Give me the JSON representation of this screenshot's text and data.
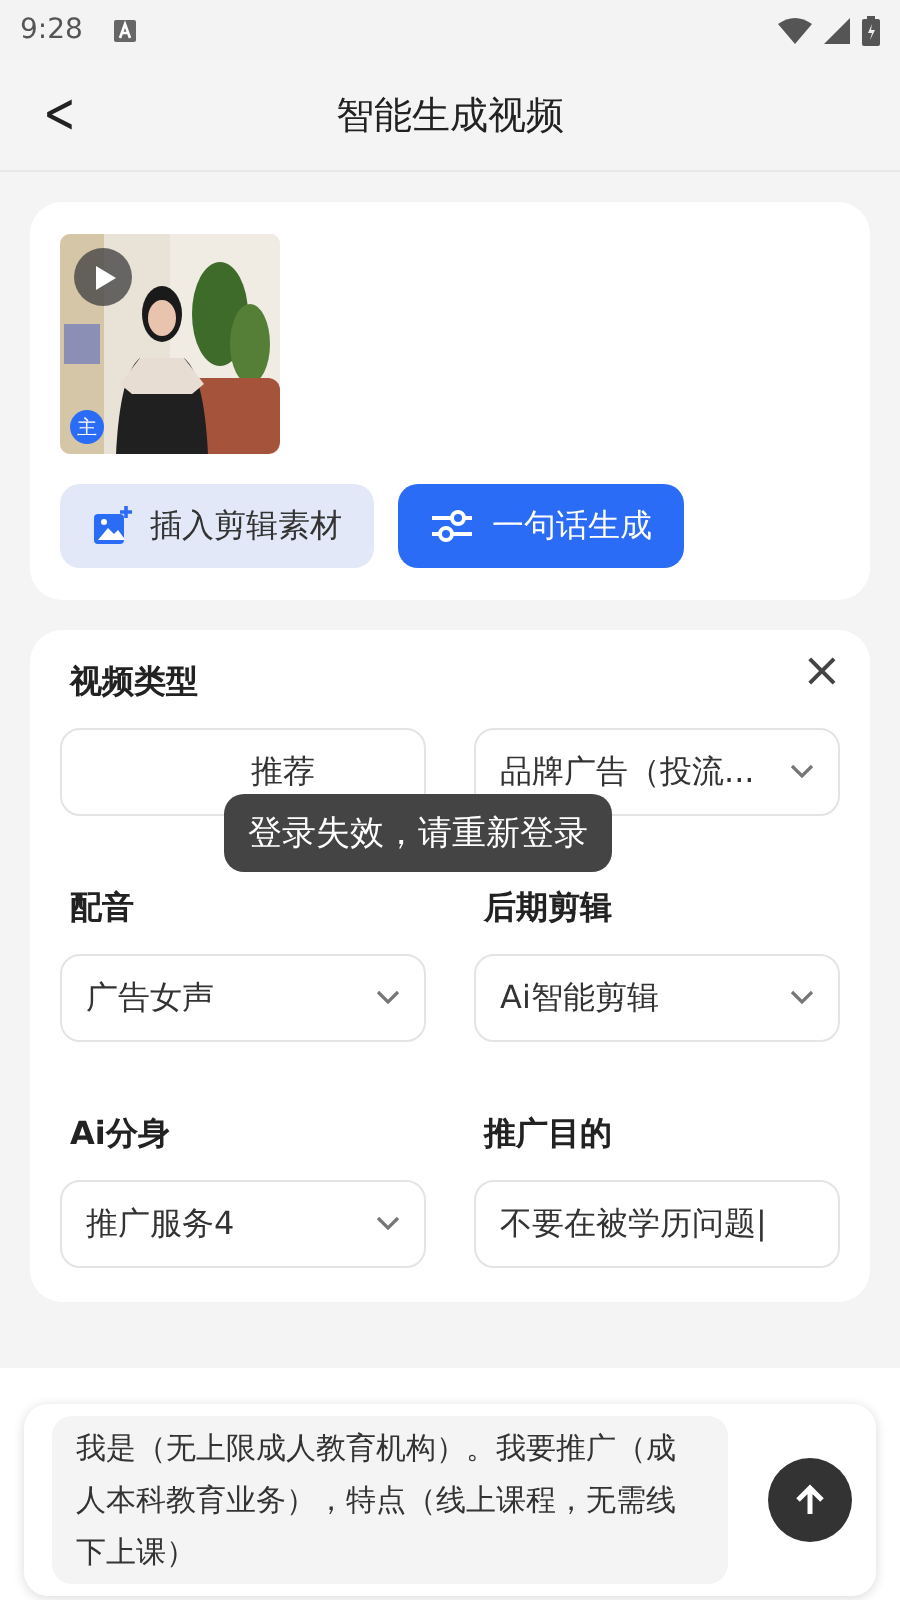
{
  "status_bar": {
    "time": "9:28"
  },
  "header": {
    "back": "<",
    "title": "智能生成视频"
  },
  "media": {
    "video": {
      "kind": "picture",
      "badge": "主"
    },
    "buttons": [
      {
        "label": "插入剪辑素材",
        "kind": "secondary"
      },
      {
        "label": "一句话生成",
        "kind": "primary"
      }
    ]
  },
  "settings": {
    "close": "×",
    "fields": [
      {
        "label": "视频类型",
        "options": [
          {
            "value": "推荐",
            "dropdown": false
          },
          {
            "value": "品牌广告（投流...",
            "dropdown": true
          }
        ]
      },
      {
        "label": "配音",
        "value": "广告女声",
        "dropdown": true
      },
      {
        "label": "后期剪辑",
        "value": "Ai智能剪辑",
        "dropdown": true
      },
      {
        "label": "Ai分身",
        "value": "推广服务4",
        "dropdown": true
      },
      {
        "label": "推广目的",
        "value": "不要在被学历问题|",
        "dropdown": false
      }
    ]
  },
  "toast": "登录失效，请重新登录",
  "prompt": {
    "text": "我是（无上限成人教育机构）。我要推广（成人本科教育业务），特点（线上课程，无需线下上课）"
  }
}
